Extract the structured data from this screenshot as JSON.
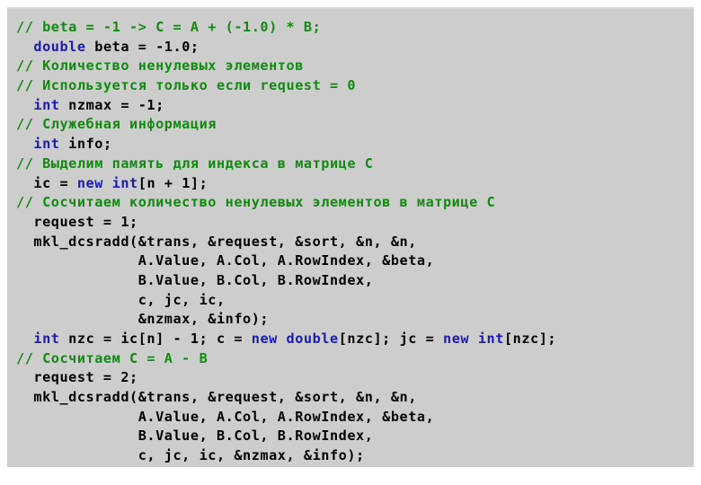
{
  "document": {
    "kind": "source-code-listing",
    "language": "C++",
    "background_color": "#cdcdcd",
    "page_background_color": "#ffffff",
    "colors": {
      "comment": "#128a12",
      "keyword": "#1a1ab4",
      "plain": "#000000"
    },
    "lines": [
      {
        "index": 1,
        "text": "// beta = -1 -> C = A + (-1.0) * B;",
        "tokens": [
          {
            "t": "// beta = -1 -> C = A + (-1.0) * B;",
            "c": "comment"
          }
        ]
      },
      {
        "index": 2,
        "text": "  double beta = -1.0;",
        "tokens": [
          {
            "t": "  ",
            "c": "plain"
          },
          {
            "t": "double",
            "c": "keyword"
          },
          {
            "t": " beta = -1.0;",
            "c": "plain"
          }
        ]
      },
      {
        "index": 3,
        "text": "// Количество ненулевых элементов",
        "tokens": [
          {
            "t": "// Количество ненулевых элементов",
            "c": "comment"
          }
        ]
      },
      {
        "index": 4,
        "text": "// Используется только если request = 0",
        "tokens": [
          {
            "t": "// Используется только если request = 0",
            "c": "comment"
          }
        ]
      },
      {
        "index": 5,
        "text": "  int nzmax = -1;",
        "tokens": [
          {
            "t": "  ",
            "c": "plain"
          },
          {
            "t": "int",
            "c": "keyword"
          },
          {
            "t": " nzmax = -1;",
            "c": "plain"
          }
        ]
      },
      {
        "index": 6,
        "text": "// Служебная информация",
        "tokens": [
          {
            "t": "// Служебная информация",
            "c": "comment"
          }
        ]
      },
      {
        "index": 7,
        "text": "  int info;",
        "tokens": [
          {
            "t": "  ",
            "c": "plain"
          },
          {
            "t": "int",
            "c": "keyword"
          },
          {
            "t": " info;",
            "c": "plain"
          }
        ]
      },
      {
        "index": 8,
        "text": "// Выделим память для индекса в матрице C",
        "tokens": [
          {
            "t": "// Выделим память для индекса в матрице C",
            "c": "comment"
          }
        ]
      },
      {
        "index": 9,
        "text": "  ic = new int[n + 1];",
        "tokens": [
          {
            "t": "  ic = ",
            "c": "plain"
          },
          {
            "t": "new",
            "c": "keyword"
          },
          {
            "t": " ",
            "c": "plain"
          },
          {
            "t": "int",
            "c": "keyword"
          },
          {
            "t": "[n + 1];",
            "c": "plain"
          }
        ]
      },
      {
        "index": 10,
        "text": "// Сосчитаем количество ненулевых элементов в матрице C",
        "tokens": [
          {
            "t": "// Сосчитаем количество ненулевых элементов в матрице C",
            "c": "comment"
          }
        ]
      },
      {
        "index": 11,
        "text": "  request = 1;",
        "tokens": [
          {
            "t": "  request = 1;",
            "c": "plain"
          }
        ]
      },
      {
        "index": 12,
        "text": "  mkl_dcsradd(&trans, &request, &sort, &n, &n,",
        "tokens": [
          {
            "t": "  mkl_dcsradd(&trans, &request, &sort, &n, &n,",
            "c": "plain"
          }
        ]
      },
      {
        "index": 13,
        "text": "              A.Value, A.Col, A.RowIndex, &beta,",
        "tokens": [
          {
            "t": "              A.Value, A.Col, A.RowIndex, &beta,",
            "c": "plain"
          }
        ]
      },
      {
        "index": 14,
        "text": "              B.Value, B.Col, B.RowIndex,",
        "tokens": [
          {
            "t": "              B.Value, B.Col, B.RowIndex,",
            "c": "plain"
          }
        ]
      },
      {
        "index": 15,
        "text": "              c, jc, ic,",
        "tokens": [
          {
            "t": "              c, jc, ic,",
            "c": "plain"
          }
        ]
      },
      {
        "index": 16,
        "text": "              &nzmax, &info);",
        "tokens": [
          {
            "t": "              &nzmax, &info);",
            "c": "plain"
          }
        ]
      },
      {
        "index": 17,
        "text": "  int nzc = ic[n] - 1; c = new double[nzc]; jc = new int[nzc];",
        "tokens": [
          {
            "t": "  ",
            "c": "plain"
          },
          {
            "t": "int",
            "c": "keyword"
          },
          {
            "t": " nzc = ic[n] - 1; c = ",
            "c": "plain"
          },
          {
            "t": "new",
            "c": "keyword"
          },
          {
            "t": " ",
            "c": "plain"
          },
          {
            "t": "double",
            "c": "keyword"
          },
          {
            "t": "[nzc]; jc = ",
            "c": "plain"
          },
          {
            "t": "new",
            "c": "keyword"
          },
          {
            "t": " ",
            "c": "plain"
          },
          {
            "t": "int",
            "c": "keyword"
          },
          {
            "t": "[nzc];",
            "c": "plain"
          }
        ]
      },
      {
        "index": 18,
        "text": "// Сосчитаем C = A - B",
        "tokens": [
          {
            "t": "// Сосчитаем C = A - B",
            "c": "comment"
          }
        ]
      },
      {
        "index": 19,
        "text": "  request = 2;",
        "tokens": [
          {
            "t": "  request = 2;",
            "c": "plain"
          }
        ]
      },
      {
        "index": 20,
        "text": "  mkl_dcsradd(&trans, &request, &sort, &n, &n,",
        "tokens": [
          {
            "t": "  mkl_dcsradd(&trans, &request, &sort, &n, &n,",
            "c": "plain"
          }
        ]
      },
      {
        "index": 21,
        "text": "              A.Value, A.Col, A.RowIndex, &beta,",
        "tokens": [
          {
            "t": "              A.Value, A.Col, A.RowIndex, &beta,",
            "c": "plain"
          }
        ]
      },
      {
        "index": 22,
        "text": "              B.Value, B.Col, B.RowIndex,",
        "tokens": [
          {
            "t": "              B.Value, B.Col, B.RowIndex,",
            "c": "plain"
          }
        ]
      },
      {
        "index": 23,
        "text": "              c, jc, ic, &nzmax, &info);",
        "tokens": [
          {
            "t": "              c, jc, ic, &nzmax, &info);",
            "c": "plain"
          }
        ]
      }
    ]
  }
}
